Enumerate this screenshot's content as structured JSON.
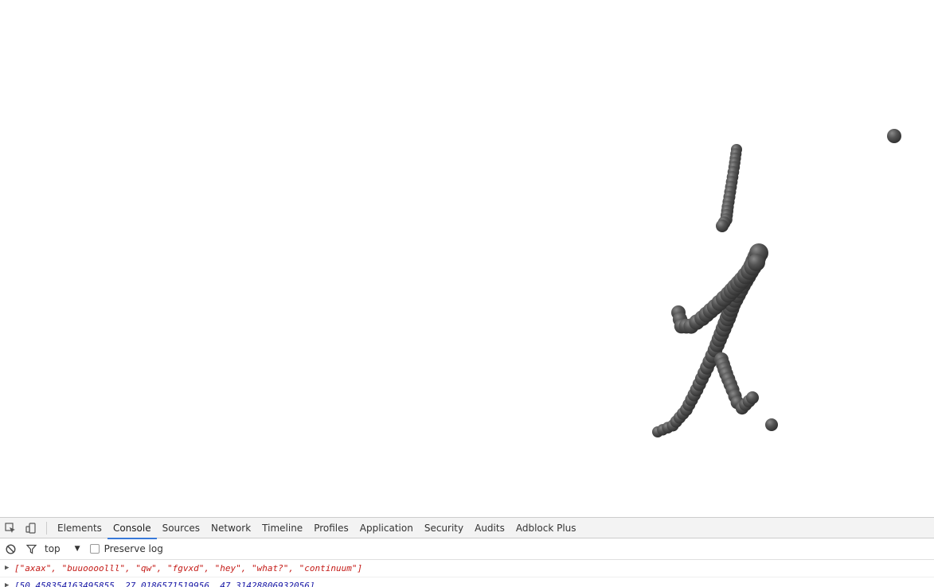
{
  "devtools": {
    "tabs": [
      "Elements",
      "Console",
      "Sources",
      "Network",
      "Timeline",
      "Profiles",
      "Application",
      "Security",
      "Audits",
      "Adblock Plus"
    ],
    "active_tab": "Console",
    "filter": {
      "context": "top",
      "preserve_log_label": "Preserve log",
      "preserve_log_checked": false
    },
    "console_lines": [
      {
        "text": "[\"axax\", \"buuoooolll\", \"qw\", \"fgvxd\", \"hey\", \"what?\", \"continuum\"]",
        "color": "#c41a16"
      },
      {
        "text": "[50.458354163495855, 27.0186571519956, 47.31428806932056]",
        "color": "#1a1aa6"
      }
    ]
  },
  "colors": {
    "sphere": "#4a4a4a",
    "tab_accent": "#3879d9"
  },
  "icons": [
    "inspect-element-icon",
    "device-toolbar-icon",
    "clear-console-icon",
    "filter-icon",
    "dropdown-arrow-icon",
    "expand-triangle-icon"
  ]
}
